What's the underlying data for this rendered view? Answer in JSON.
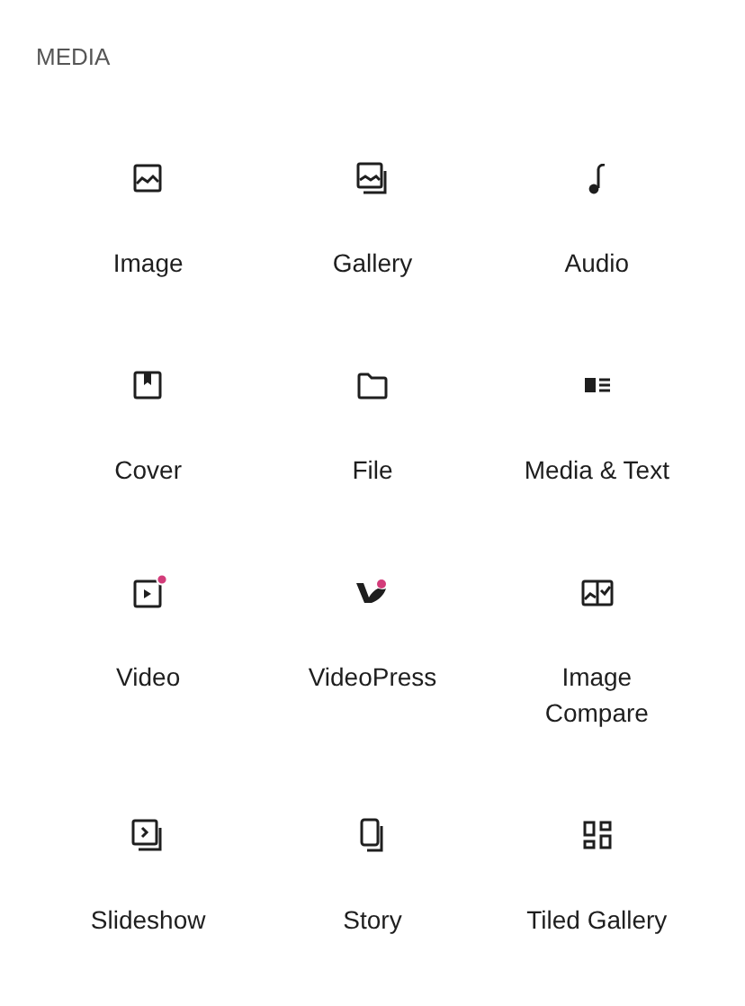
{
  "section": {
    "title": "MEDIA"
  },
  "blocks": [
    {
      "kind": "image",
      "label": "Image"
    },
    {
      "kind": "gallery",
      "label": "Gallery"
    },
    {
      "kind": "audio",
      "label": "Audio"
    },
    {
      "kind": "cover",
      "label": "Cover"
    },
    {
      "kind": "file",
      "label": "File"
    },
    {
      "kind": "media-text",
      "label": "Media & Text"
    },
    {
      "kind": "video",
      "label": "Video"
    },
    {
      "kind": "videopress",
      "label": "VideoPress"
    },
    {
      "kind": "image-compare",
      "label": "Image Compare"
    },
    {
      "kind": "slideshow",
      "label": "Slideshow"
    },
    {
      "kind": "story",
      "label": "Story"
    },
    {
      "kind": "tiled-gallery",
      "label": "Tiled Gallery"
    }
  ]
}
